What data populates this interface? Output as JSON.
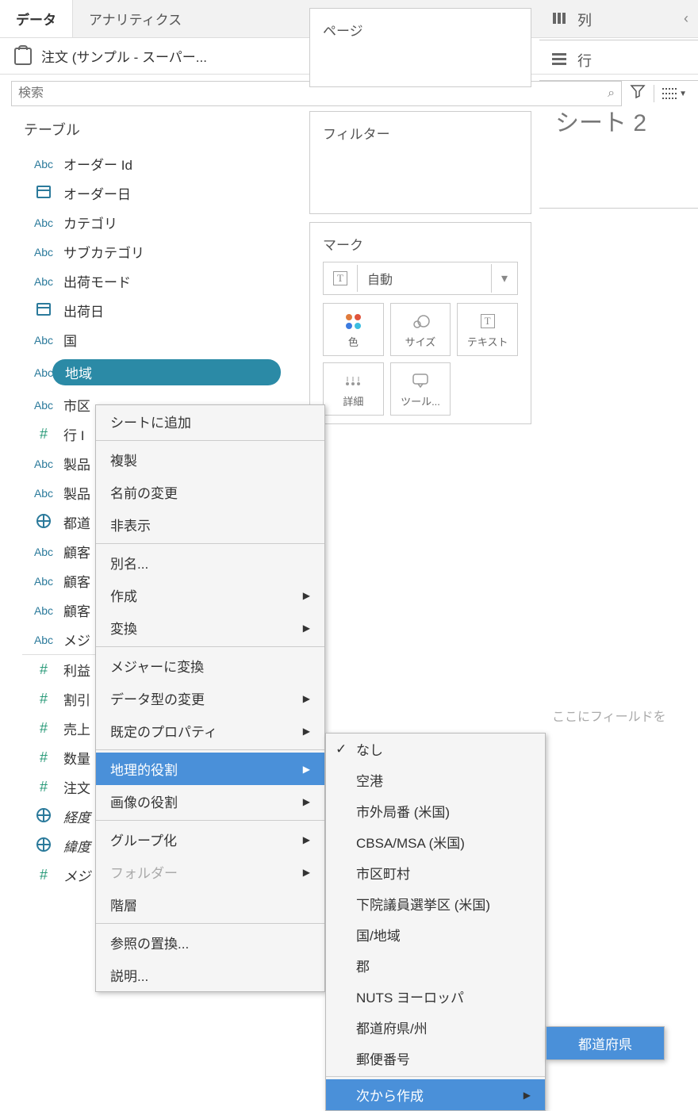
{
  "sidebar": {
    "tabs": {
      "data": "データ",
      "analytics": "アナリティクス"
    },
    "data_source": "注文 (サンプル - スーパー...",
    "search_placeholder": "検索",
    "section_tables": "テーブル",
    "fields": [
      {
        "type": "Abc",
        "name": "オーダー Id"
      },
      {
        "type": "date",
        "name": "オーダー日"
      },
      {
        "type": "Abc",
        "name": "カテゴリ"
      },
      {
        "type": "Abc",
        "name": "サブカテゴリ"
      },
      {
        "type": "Abc",
        "name": "出荷モード"
      },
      {
        "type": "date",
        "name": "出荷日"
      },
      {
        "type": "Abc",
        "name": "国"
      },
      {
        "type": "Abc",
        "name": "地域",
        "selected": true
      },
      {
        "type": "Abc",
        "name": "市区"
      },
      {
        "type": "hash",
        "name": "行 I"
      },
      {
        "type": "Abc",
        "name": "製品"
      },
      {
        "type": "Abc",
        "name": "製品"
      },
      {
        "type": "globe",
        "name": "都道"
      },
      {
        "type": "Abc",
        "name": "顧客"
      },
      {
        "type": "Abc",
        "name": "顧客"
      },
      {
        "type": "Abc",
        "name": "顧客"
      },
      {
        "type": "Abc",
        "name": "メジ"
      },
      {
        "type": "hash",
        "name": "利益",
        "sep_before": true
      },
      {
        "type": "hash",
        "name": "割引"
      },
      {
        "type": "hash",
        "name": "売上"
      },
      {
        "type": "hash",
        "name": "数量"
      },
      {
        "type": "hash",
        "name": "注文"
      },
      {
        "type": "globe",
        "name": "経度",
        "italic": true
      },
      {
        "type": "globe",
        "name": "緯度",
        "italic": true
      },
      {
        "type": "hash",
        "name": "メジ",
        "italic": true
      }
    ]
  },
  "shelves": {
    "pages": "ページ",
    "filters": "フィルター",
    "marks_title": "マーク",
    "marks_type": "自動",
    "encodings": [
      {
        "id": "color",
        "label": "色"
      },
      {
        "id": "size",
        "label": "サイズ"
      },
      {
        "id": "text",
        "label": "テキスト"
      },
      {
        "id": "detail",
        "label": "詳細"
      },
      {
        "id": "tooltip",
        "label": "ツール..."
      }
    ]
  },
  "rail": {
    "columns": "列",
    "rows": "行",
    "sheet_title": "シート 2",
    "drop_hint": "ここにフィールドを"
  },
  "context_menu": {
    "items": [
      {
        "label": "シートに追加"
      },
      {
        "sep": true
      },
      {
        "label": "複製"
      },
      {
        "label": "名前の変更"
      },
      {
        "label": "非表示"
      },
      {
        "sep": true
      },
      {
        "label": "別名..."
      },
      {
        "label": "作成",
        "arrow": true
      },
      {
        "label": "変換",
        "arrow": true
      },
      {
        "sep": true
      },
      {
        "label": "メジャーに変換"
      },
      {
        "label": "データ型の変更",
        "arrow": true
      },
      {
        "label": "既定のプロパティ",
        "arrow": true
      },
      {
        "sep": true
      },
      {
        "label": "地理的役割",
        "arrow": true,
        "highlighted": true
      },
      {
        "label": "画像の役割",
        "arrow": true
      },
      {
        "sep": true
      },
      {
        "label": "グループ化",
        "arrow": true
      },
      {
        "label": "フォルダー",
        "arrow": true,
        "disabled": true
      },
      {
        "label": "階層"
      },
      {
        "sep": true
      },
      {
        "label": "参照の置換..."
      },
      {
        "label": "説明..."
      }
    ]
  },
  "submenu": {
    "items": [
      {
        "label": "なし",
        "checked": true
      },
      {
        "label": "空港"
      },
      {
        "label": "市外局番 (米国)"
      },
      {
        "label": "CBSA/MSA (米国)"
      },
      {
        "label": "市区町村"
      },
      {
        "label": "下院議員選挙区 (米国)"
      },
      {
        "label": "国/地域"
      },
      {
        "label": "郡"
      },
      {
        "label": "NUTS ヨーロッパ"
      },
      {
        "label": "都道府県/州"
      },
      {
        "label": "郵便番号"
      },
      {
        "sep": true
      },
      {
        "label": "次から作成",
        "arrow": true,
        "highlighted": true
      }
    ]
  },
  "flyout": {
    "item": "都道府県"
  }
}
